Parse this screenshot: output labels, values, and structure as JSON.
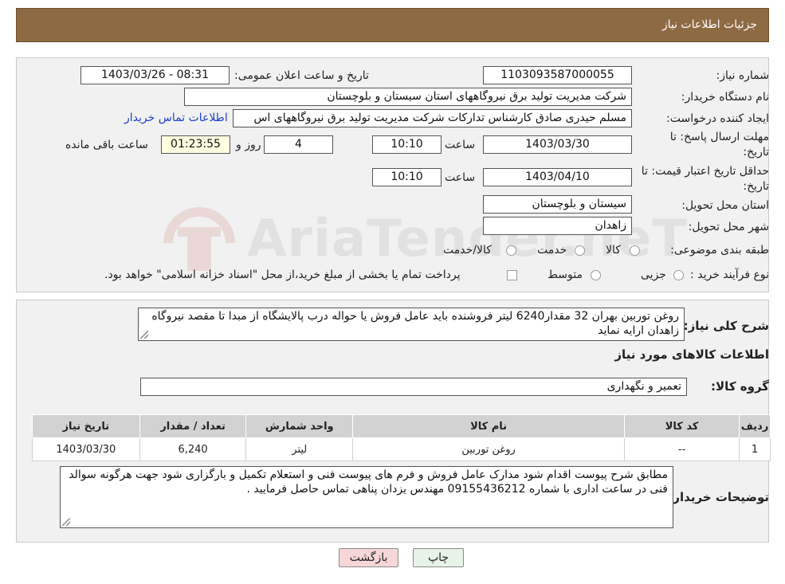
{
  "header": {
    "title": "جزئیات اطلاعات نیاز"
  },
  "form": {
    "need_number_label": "شماره نیاز:",
    "need_number": "1103093587000055",
    "announce_label": "تاریخ و ساعت اعلان عمومی:",
    "announce_value": "1403/03/26 - 08:31",
    "buyer_org_label": "نام دستگاه خریدار:",
    "buyer_org": "شرکت مدیریت تولید برق نیروگاههای استان سیستان و بلوچستان",
    "creator_label": "ایجاد کننده درخواست:",
    "creator": "مسلم حیدری صادق کارشناس تدارکات شرکت مدیریت تولید برق نیروگاههای اس",
    "contact_link": "اطلاعات تماس خریدار",
    "deadline_label_1": "مهلت ارسال پاسخ: تا",
    "deadline_label_2": "تاریخ:",
    "deadline_date": "1403/03/30",
    "time_label": "ساعت",
    "deadline_time": "10:10",
    "days_value": "4",
    "days_label": "روز و",
    "remaining_time": "01:23:55",
    "remaining_label": "ساعت باقی مانده",
    "validity_label_1": "حداقل تاریخ اعتبار قیمت: تا",
    "validity_label_2": "تاریخ:",
    "validity_date": "1403/04/10",
    "validity_time": "10:10",
    "province_label": "استان محل تحویل:",
    "province": "سیستان و بلوچستان",
    "city_label": "شهر محل تحویل:",
    "city": "زاهدان",
    "category_label": "طبقه بندی موضوعی:",
    "category_options": [
      "کالا",
      "خدمت",
      "کالا/خدمت"
    ],
    "process_label": "نوع فرآیند خرید :",
    "process_options": [
      "جزیی",
      "متوسط"
    ],
    "payment_note": "پرداخت تمام یا بخشی از مبلغ خرید،از محل \"اسناد خزانه اسلامی\" خواهد بود."
  },
  "summary": {
    "label": "شرح کلی نیاز:",
    "text": "روغن  توربین بهران 32  مقدار6240 لیتر  فروشنده باید عامل فروش یا حواله درب پالایشگاه از مبدا تا مقصد نیروگاه زاهدان ارایه نماید",
    "goods_info_title": "اطلاعات کالاهای مورد نیاز",
    "group_label": "گروه کالا:",
    "group_value": "تعمیر و نگهداری"
  },
  "table": {
    "headers": [
      "ردیف",
      "کد کالا",
      "نام کالا",
      "واحد شمارش",
      "تعداد / مقدار",
      "تاریخ نیاز"
    ],
    "rows": [
      [
        "1",
        "--",
        "روغن توربین",
        "لیتر",
        "6,240",
        "1403/03/30"
      ]
    ]
  },
  "buyer_notes": {
    "label": "توضیحات خریدار:",
    "text": "مطابق شرح پیوست اقدام شود مدارک عامل فروش و فرم های پیوست فنی  و استعلام تکمیل و بارگزاری شود  جهت هرگونه سوالد فنی در ساعت اداری با شماره 09155436212 مهندس یزدان پناهی تماس حاصل فرمایید ."
  },
  "buttons": {
    "print": "چاپ",
    "back": "بازگشت"
  },
  "watermark": {
    "text": "AriaTender.neT"
  },
  "colors": {
    "header_bg": "#8e6a43",
    "link": "#1a3fd0",
    "back_button_bg": "#f6d6d6",
    "print_button_bg": "#e6f3e6"
  }
}
